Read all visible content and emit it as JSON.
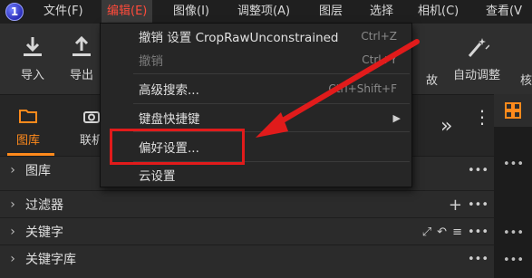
{
  "menubar": {
    "logo": "1",
    "items": [
      {
        "label": "文件(F)"
      },
      {
        "label": "编辑(E)"
      },
      {
        "label": "图像(I)"
      },
      {
        "label": "调整项(A)"
      },
      {
        "label": "图层"
      },
      {
        "label": "选择"
      },
      {
        "label": "相机(C)"
      },
      {
        "label": "查看(V"
      }
    ]
  },
  "toolbar": {
    "import_label": "导入",
    "export_label": "导出",
    "partial_label": "故",
    "auto_adjust_label": "自动调整",
    "edge_label": "核"
  },
  "tabs": {
    "library_label": "图库",
    "link_label": "联机"
  },
  "dropdown": {
    "items": [
      {
        "label": "撤销 设置 CropRawUnconstrained",
        "shortcut": "Ctrl+Z",
        "disabled": false
      },
      {
        "label": "撤销",
        "shortcut": "Ctrl+Y",
        "disabled": true
      },
      {
        "label": "高级搜索...",
        "shortcut": "Ctrl+Shift+F",
        "disabled": false
      },
      {
        "label": "键盘快捷键",
        "shortcut": "",
        "disabled": false
      },
      {
        "label": "偏好设置...",
        "shortcut": "",
        "disabled": false
      },
      {
        "label": "云设置",
        "shortcut": "",
        "disabled": false
      }
    ],
    "submenu_arrow": "▶"
  },
  "panels": [
    {
      "label": "图库"
    },
    {
      "label": "过滤器"
    },
    {
      "label": "关键字"
    },
    {
      "label": "关键字库"
    }
  ],
  "colors": {
    "accent_red": "#e11b1b",
    "active_menu": "#ff4a3a",
    "selected_tab": "#ff8a1c"
  }
}
